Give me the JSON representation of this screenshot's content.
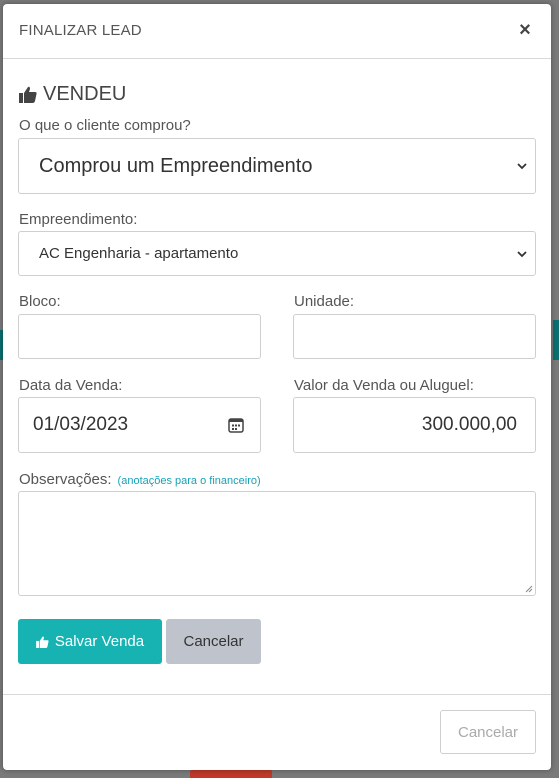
{
  "modal": {
    "title": "FINALIZAR LEAD",
    "close_label": "×",
    "section_title": "VENDEU"
  },
  "form": {
    "purchase_type": {
      "label": "O que o cliente comprou?",
      "value": "Comprou um Empreendimento"
    },
    "development": {
      "label": "Empreendimento:",
      "value": "AC Engenharia - apartamento"
    },
    "block": {
      "label": "Bloco:",
      "value": ""
    },
    "unit": {
      "label": "Unidade:",
      "value": ""
    },
    "sale_date": {
      "label": "Data da Venda:",
      "value": "01/03/2023"
    },
    "sale_value": {
      "label": "Valor da Venda ou Aluguel:",
      "value": "300.000,00"
    },
    "notes": {
      "label": "Observações:",
      "hint": "(anotações para o financeiro)",
      "value": ""
    }
  },
  "buttons": {
    "save_label": "Salvar Venda",
    "cancel_label": "Cancelar",
    "footer_cancel_label": "Cancelar"
  },
  "colors": {
    "accent": "#17b3b3",
    "hint": "#17a2b8",
    "cancel_bg": "#bfc4cc"
  },
  "icons": {
    "section": "thumbs-up-icon",
    "save": "thumbs-up-icon",
    "date": "calendar-icon",
    "close": "close-icon"
  }
}
